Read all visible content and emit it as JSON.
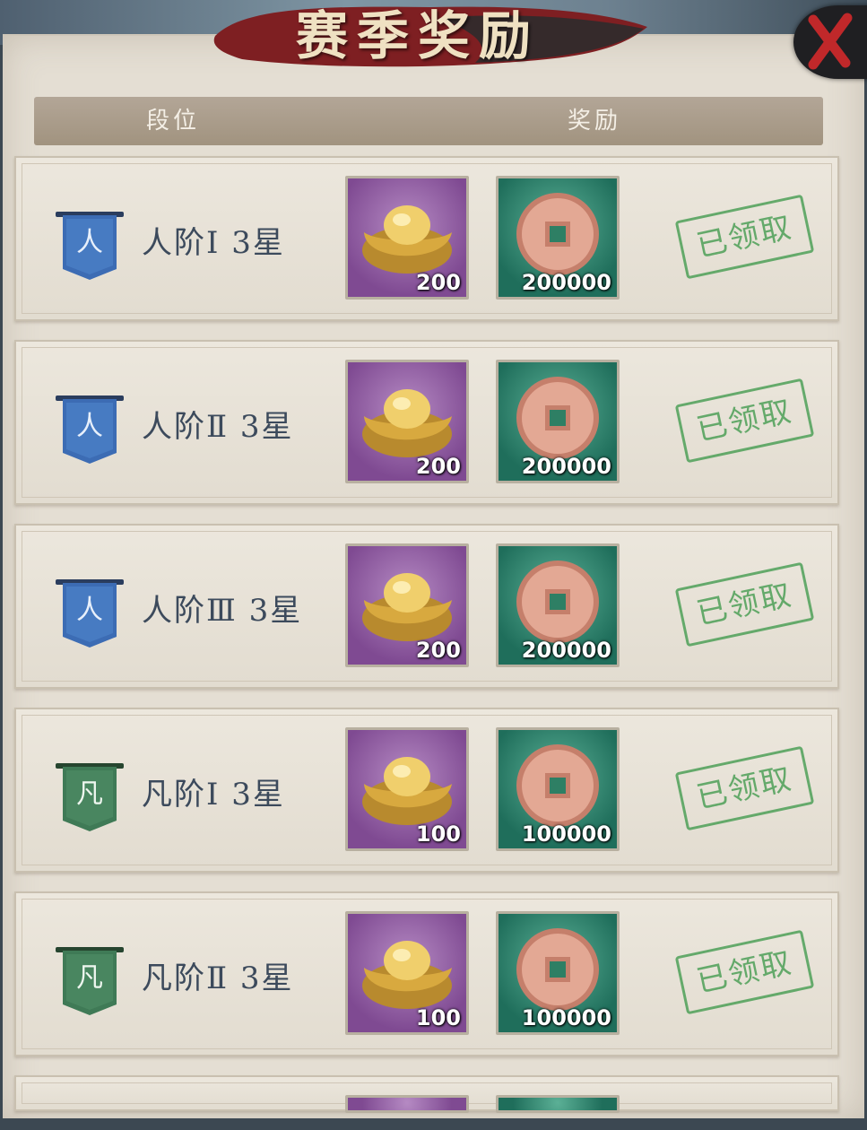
{
  "title": "赛季奖励",
  "header": {
    "rank_col": "段位",
    "reward_col": "奖励"
  },
  "claimed_label": "已领取",
  "icons": {
    "close": "close-x-icon",
    "tier_ren": "ren-banner-icon",
    "tier_fan": "fan-banner-icon",
    "gold": "gold-ingot-icon",
    "coin": "copper-coin-icon"
  },
  "colors": {
    "ren_banner": "#3c6cb4",
    "fan_banner": "#3f7a56",
    "stamp": "#4ea058",
    "close_x": "#c0282a"
  },
  "rows": [
    {
      "rank": "人阶Ⅰ 3星",
      "tier": "ren",
      "tier_char": "人",
      "gold": "200",
      "coins": "200000"
    },
    {
      "rank": "人阶Ⅱ 3星",
      "tier": "ren",
      "tier_char": "人",
      "gold": "200",
      "coins": "200000"
    },
    {
      "rank": "人阶Ⅲ 3星",
      "tier": "ren",
      "tier_char": "人",
      "gold": "200",
      "coins": "200000"
    },
    {
      "rank": "凡阶Ⅰ 3星",
      "tier": "fan",
      "tier_char": "凡",
      "gold": "100",
      "coins": "100000"
    },
    {
      "rank": "凡阶Ⅱ 3星",
      "tier": "fan",
      "tier_char": "凡",
      "gold": "100",
      "coins": "100000"
    }
  ]
}
